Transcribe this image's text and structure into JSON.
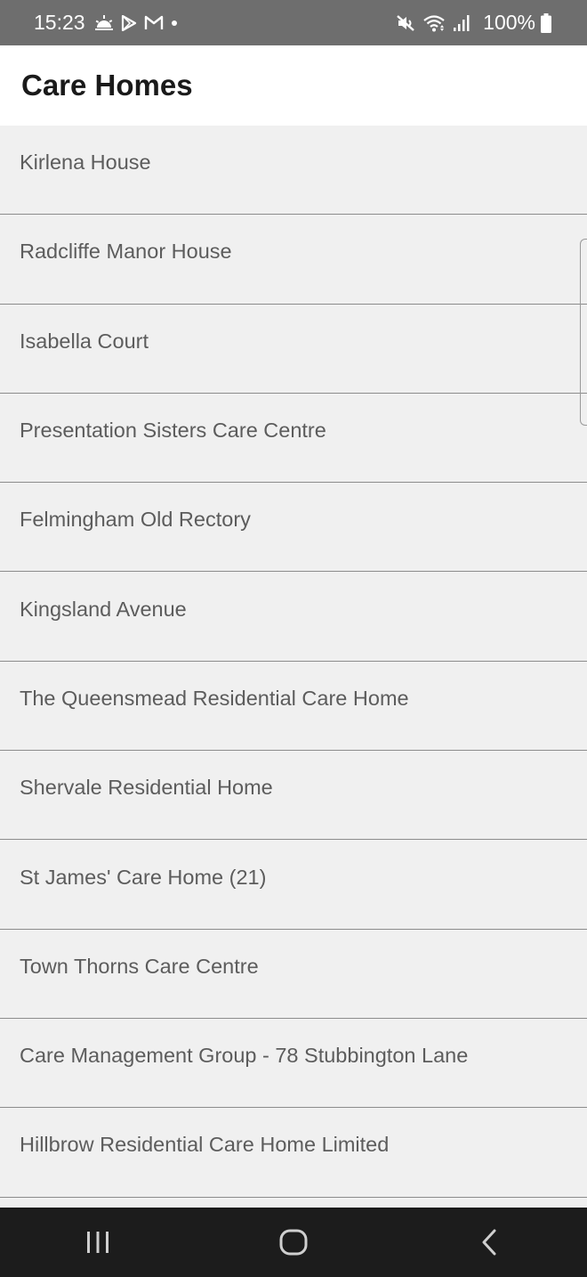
{
  "status_bar": {
    "time": "15:23",
    "battery": "100%",
    "left_icons": [
      "weather-sunrise-icon",
      "play-store-icon",
      "gmail-icon",
      "notification-dot-icon"
    ],
    "right_icons": [
      "mute-icon",
      "wifi-icon",
      "signal-icon",
      "battery-icon"
    ]
  },
  "header": {
    "title": "Care Homes"
  },
  "list": {
    "items": [
      "Kirlena House",
      "Radcliffe Manor House",
      "Isabella Court",
      "Presentation Sisters Care Centre",
      "Felmingham Old Rectory",
      "Kingsland Avenue",
      "The Queensmead Residential Care Home",
      "Shervale Residential Home",
      "St James' Care Home (21)",
      "Town Thorns Care Centre",
      "Care Management Group - 78 Stubbington Lane",
      "Hillbrow Residential Care Home Limited"
    ]
  },
  "nav_bar": {
    "buttons": [
      "recent-apps-icon",
      "home-icon",
      "back-icon"
    ]
  },
  "colors": {
    "status_bar_bg": "#6e6e6e",
    "app_bar_bg": "#ffffff",
    "list_bg": "#f0f0f0",
    "divider": "#8c8c8c",
    "item_text": "#5c5c5c",
    "nav_bar_bg": "#1c1c1c"
  }
}
